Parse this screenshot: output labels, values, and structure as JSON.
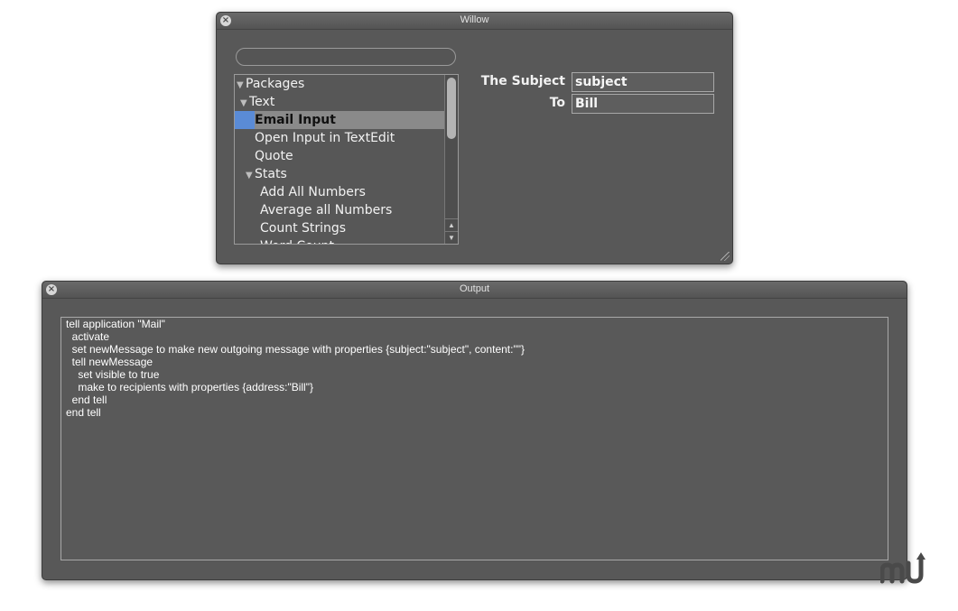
{
  "willow_window": {
    "title": "Willow",
    "search": {
      "value": "",
      "placeholder": ""
    },
    "tree": [
      {
        "label": "Packages",
        "level": 0,
        "expanded": true,
        "selected": false
      },
      {
        "label": "Text",
        "level": 1,
        "expanded": true,
        "selected": false
      },
      {
        "label": "Email Input",
        "level": 2,
        "selected": true
      },
      {
        "label": "Open Input in TextEdit",
        "level": 2,
        "selected": false
      },
      {
        "label": "Quote",
        "level": 2,
        "selected": false
      },
      {
        "label": "Stats",
        "level": 2,
        "expanded": true,
        "selected": false
      },
      {
        "label": "Add All Numbers",
        "level": 3,
        "selected": false
      },
      {
        "label": "Average all Numbers",
        "level": 3,
        "selected": false
      },
      {
        "label": "Count Strings",
        "level": 3,
        "selected": false
      },
      {
        "label": "Word Count",
        "level": 3,
        "selected": false
      }
    ],
    "fields": [
      {
        "label": "The Subject",
        "value": "subject"
      },
      {
        "label": "To",
        "value": "Bill"
      }
    ]
  },
  "output_window": {
    "title": "Output",
    "text": "tell application \"Mail\"\n  activate\n  set newMessage to make new outgoing message with properties {subject:\"subject\", content:\"\"}\n  tell newMessage\n    set visible to true\n    make to recipients with properties {address:\"Bill\"}\n  end tell\nend tell"
  },
  "colors": {
    "hud_background": "#585858",
    "selection": "#5a8bd6"
  },
  "icons": {
    "close": "close-icon",
    "resize": "resize-grip-icon",
    "scroll_up": "arrow-up-icon",
    "scroll_down": "arrow-down-icon",
    "watermark": "macupdate-logo"
  }
}
